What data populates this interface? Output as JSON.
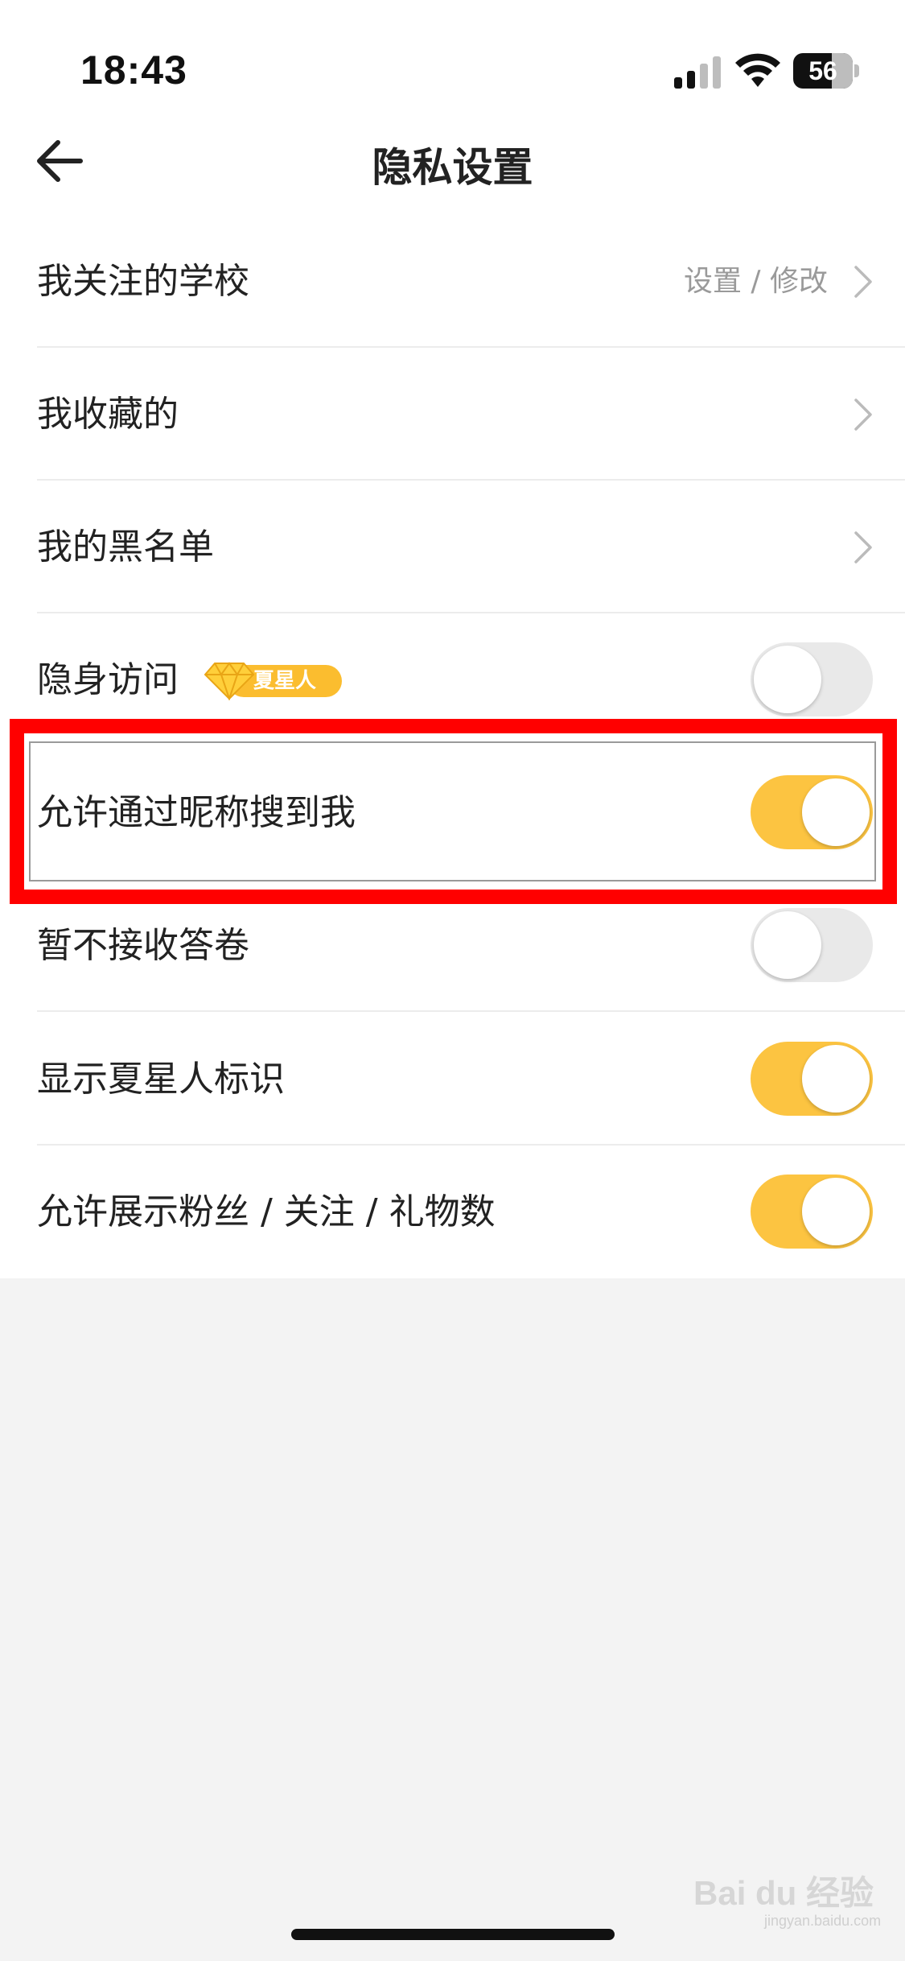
{
  "status_bar": {
    "time": "18:43",
    "battery": "56"
  },
  "nav": {
    "title": "隐私设置"
  },
  "rows": [
    {
      "label": "我关注的学校",
      "hint": "设置 / 修改",
      "type": "link"
    },
    {
      "label": "我收藏的",
      "type": "link"
    },
    {
      "label": "我的黑名单",
      "type": "link"
    },
    {
      "label": "隐身访问",
      "badge": "夏星人",
      "type": "toggle",
      "on": false
    },
    {
      "label": "允许通过昵称搜到我",
      "type": "toggle",
      "on": true
    },
    {
      "label": "暂不接收答卷",
      "type": "toggle",
      "on": false
    },
    {
      "label": "显示夏星人标识",
      "type": "toggle",
      "on": true
    },
    {
      "label": "允许展示粉丝 / 关注 / 礼物数",
      "type": "toggle",
      "on": true
    }
  ],
  "watermark": {
    "text": "Bai du 经验",
    "sub": "jingyan.baidu.com"
  },
  "colors": {
    "accent": "#fcc441",
    "highlight": "#ff0000",
    "toggle_off": "#e9e9e9"
  },
  "icons": [
    "back-arrow-icon",
    "chevron-right-icon",
    "signal-icon",
    "wifi-icon",
    "battery-icon",
    "diamond-icon"
  ]
}
